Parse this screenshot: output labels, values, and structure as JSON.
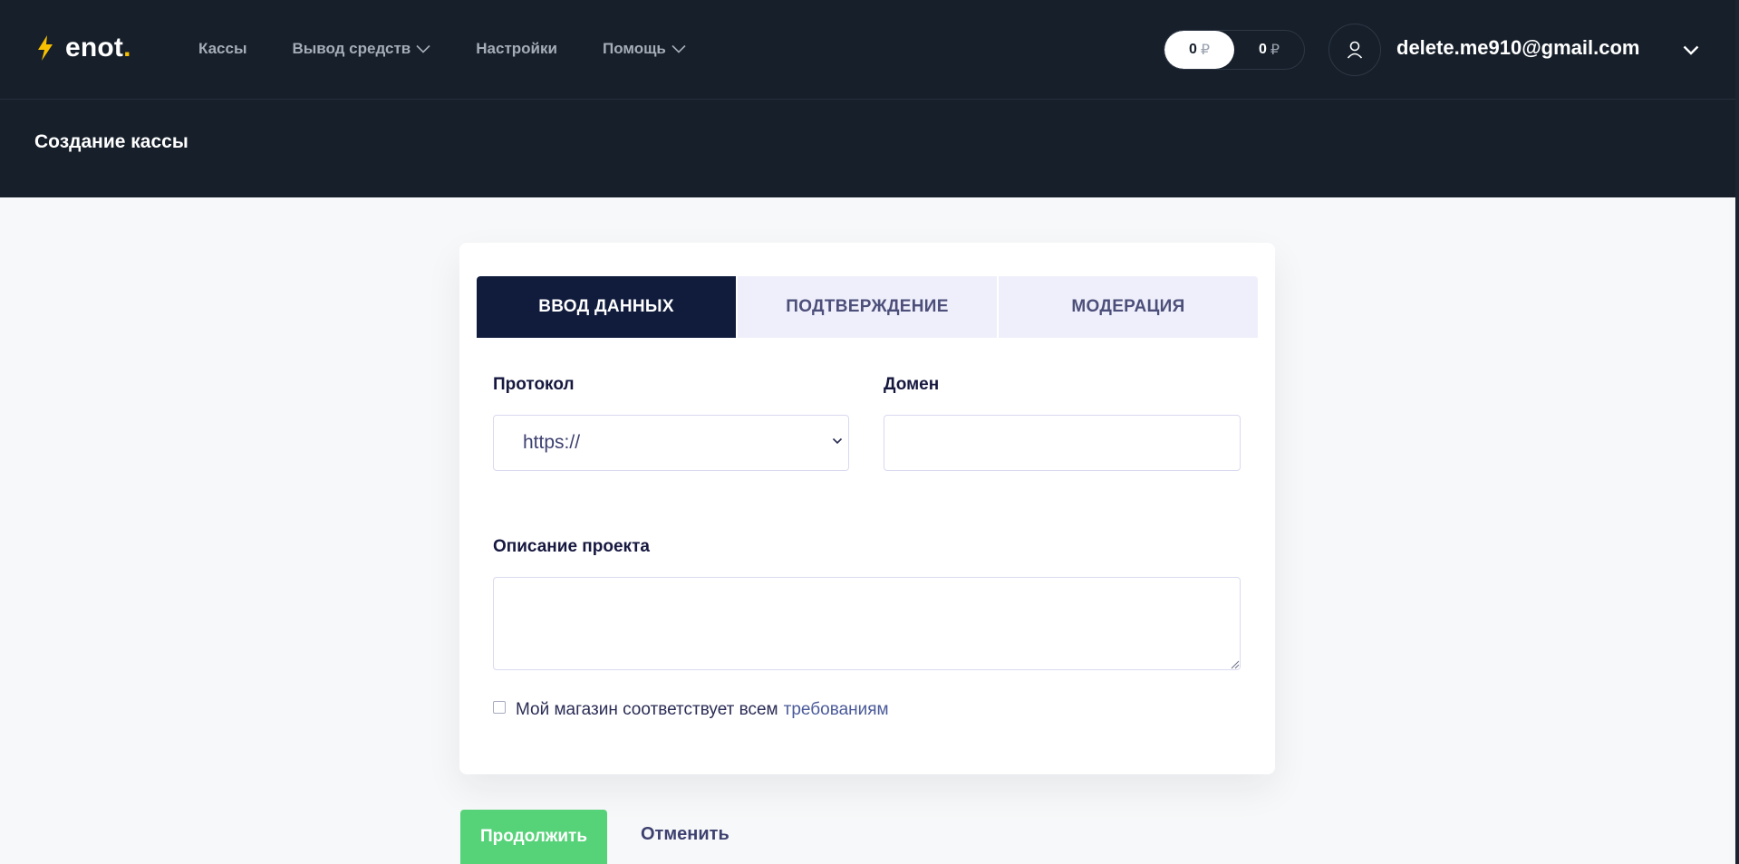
{
  "brand": {
    "name": "enot",
    "dot": ".",
    "accent_color": "#f6c000"
  },
  "nav": {
    "items": [
      {
        "label": "Кассы",
        "dropdown": false
      },
      {
        "label": "Вывод средств",
        "dropdown": true
      },
      {
        "label": "Настройки",
        "dropdown": false
      },
      {
        "label": "Помощь",
        "dropdown": true
      }
    ]
  },
  "balances": [
    {
      "amount": "0",
      "currency": "₽",
      "active": true
    },
    {
      "amount": "0",
      "currency": "₽",
      "active": false
    }
  ],
  "user": {
    "email": "delete.me910@gmail.com",
    "avatar_icon": "user-icon",
    "menu_icon": "chevron-down-icon"
  },
  "page": {
    "title": "Создание кассы"
  },
  "steps": [
    {
      "label": "ВВОД ДАННЫХ",
      "active": true
    },
    {
      "label": "ПОДТВЕРЖДЕНИЕ",
      "active": false
    },
    {
      "label": "МОДЕРАЦИЯ",
      "active": false
    }
  ],
  "form": {
    "protocol": {
      "label": "Протокол",
      "value": "https://"
    },
    "domain": {
      "label": "Домен",
      "value": "",
      "placeholder": ""
    },
    "description": {
      "label": "Описание проекта",
      "value": "",
      "placeholder": ""
    },
    "agree": {
      "text": "Мой магазин соответствует всем",
      "link": "требованиям",
      "checked": false
    }
  },
  "actions": {
    "continue_label": "Продолжить",
    "cancel_label": "Отменить"
  },
  "colors": {
    "header_bg": "#161f2a",
    "step_active_bg": "#111c3d",
    "step_inactive_bg": "#efeffb",
    "continue_bg": "#56d278"
  }
}
